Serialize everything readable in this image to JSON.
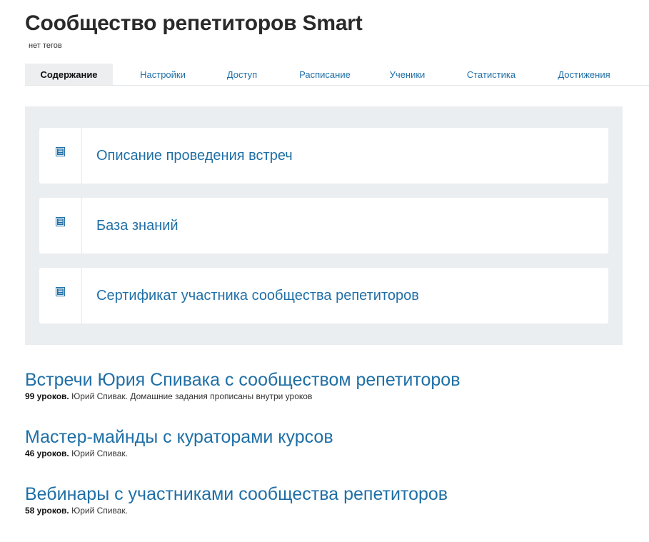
{
  "header": {
    "title": "Сообщество репетиторов Smart",
    "tags": "нет тегов"
  },
  "tabs": [
    {
      "label": "Содержание",
      "active": true
    },
    {
      "label": "Настройки",
      "active": false
    },
    {
      "label": "Доступ",
      "active": false
    },
    {
      "label": "Расписание",
      "active": false
    },
    {
      "label": "Ученики",
      "active": false
    },
    {
      "label": "Статистика",
      "active": false
    },
    {
      "label": "Достижения",
      "active": false
    }
  ],
  "folders": [
    {
      "icon": "document-list-icon",
      "title": "Описание проведения встреч"
    },
    {
      "icon": "document-list-icon",
      "title": "База знаний"
    },
    {
      "icon": "document-list-icon",
      "title": "Сертификат участника сообщества репетиторов"
    }
  ],
  "courses": [
    {
      "title": "Встречи Юрия Спивака с сообществом репетиторов",
      "lessons": "99 уроков.",
      "details": "Юрий Спивак. Домашние задания прописаны внутри уроков"
    },
    {
      "title": "Мастер-майнды с кураторами курсов",
      "lessons": "46 уроков.",
      "details": "Юрий Спивак."
    },
    {
      "title": "Вебинары с участниками сообщества репетиторов",
      "lessons": "58 уроков.",
      "details": "Юрий Спивак."
    }
  ],
  "colors": {
    "link": "#1f6fa6",
    "panel_bg": "#ebeef0",
    "active_tab_bg": "#eceef0"
  }
}
